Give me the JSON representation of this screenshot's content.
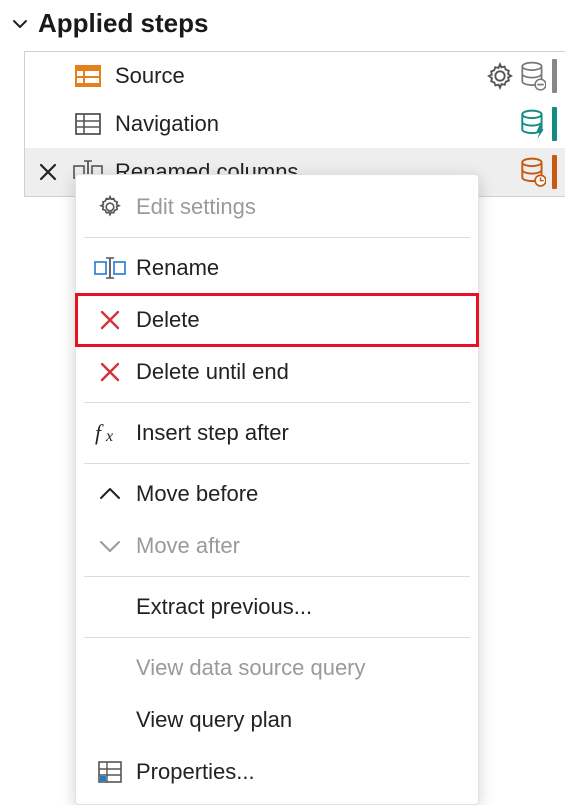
{
  "section": {
    "title": "Applied steps"
  },
  "steps": [
    {
      "label": "Source",
      "icon": "table-orange-icon",
      "has_settings": true,
      "right_db": "grey",
      "bar": "grey"
    },
    {
      "label": "Navigation",
      "icon": "table-grid-icon",
      "has_settings": false,
      "right_db": "teal-bolt",
      "bar": "teal"
    },
    {
      "label": "Renamed columns",
      "icon": "rename-icon",
      "has_settings": false,
      "right_db": "orange-clock",
      "bar": "orange",
      "selected": true,
      "deletable": true
    }
  ],
  "context_menu": {
    "items": [
      {
        "label": "Edit settings",
        "icon": "gear-icon",
        "disabled": true
      },
      {
        "sep": true
      },
      {
        "label": "Rename",
        "icon": "rename-icon"
      },
      {
        "label": "Delete",
        "icon": "x-red-icon",
        "highlighted": true
      },
      {
        "label": "Delete until end",
        "icon": "x-red-icon"
      },
      {
        "sep": true
      },
      {
        "label": "Insert step after",
        "icon": "fx-icon"
      },
      {
        "sep": true
      },
      {
        "label": "Move before",
        "icon": "chevron-up-icon"
      },
      {
        "label": "Move after",
        "icon": "chevron-down-icon",
        "disabled": true
      },
      {
        "sep": true
      },
      {
        "label": "Extract previous...",
        "icon": ""
      },
      {
        "sep": true
      },
      {
        "label": "View data source query",
        "icon": "",
        "disabled": true
      },
      {
        "label": "View query plan",
        "icon": ""
      },
      {
        "label": "Properties...",
        "icon": "properties-icon"
      }
    ]
  }
}
